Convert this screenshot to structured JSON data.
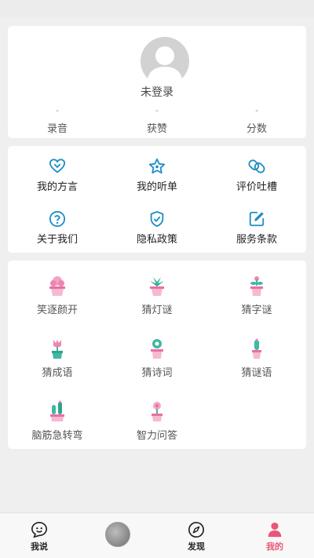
{
  "profile": {
    "avatar_icon": "default-user-avatar",
    "login_status": "未登录",
    "stats": [
      {
        "value": "-",
        "label": "录音"
      },
      {
        "value": "-",
        "label": "获赞"
      },
      {
        "value": "-",
        "label": "分数"
      }
    ]
  },
  "menu": {
    "items": [
      {
        "label": "我的方言",
        "icon": "heart-icon"
      },
      {
        "label": "我的听单",
        "icon": "star-icon"
      },
      {
        "label": "评价吐槽",
        "icon": "link-icon"
      },
      {
        "label": "关于我们",
        "icon": "question-icon"
      },
      {
        "label": "隐私政策",
        "icon": "shield-icon"
      },
      {
        "label": "服务条款",
        "icon": "edit-icon"
      }
    ],
    "accent_color": "#1e8fc4"
  },
  "games": {
    "items": [
      {
        "label": "笑逐颜开",
        "icon": "pink-flower-pot-icon"
      },
      {
        "label": "猜灯谜",
        "icon": "green-plant-pot-icon"
      },
      {
        "label": "猜字谜",
        "icon": "pink-sprout-pot-icon"
      },
      {
        "label": "猜成语",
        "icon": "tulip-pot-icon"
      },
      {
        "label": "猜诗词",
        "icon": "teal-flower-pot-icon"
      },
      {
        "label": "猜谜语",
        "icon": "cactus-pot-icon"
      },
      {
        "label": "脑筋急转弯",
        "icon": "double-cactus-pot-icon"
      },
      {
        "label": "智力问答",
        "icon": "pink-bud-pot-icon"
      }
    ]
  },
  "tabbar": {
    "tabs": [
      {
        "label": "我说",
        "icon": "speech-face-icon"
      },
      {
        "label": "",
        "icon": "center-avatar-icon"
      },
      {
        "label": "发现",
        "icon": "compass-icon"
      },
      {
        "label": "我的",
        "icon": "user-icon",
        "active": true
      }
    ],
    "active_color": "#e8577a"
  }
}
